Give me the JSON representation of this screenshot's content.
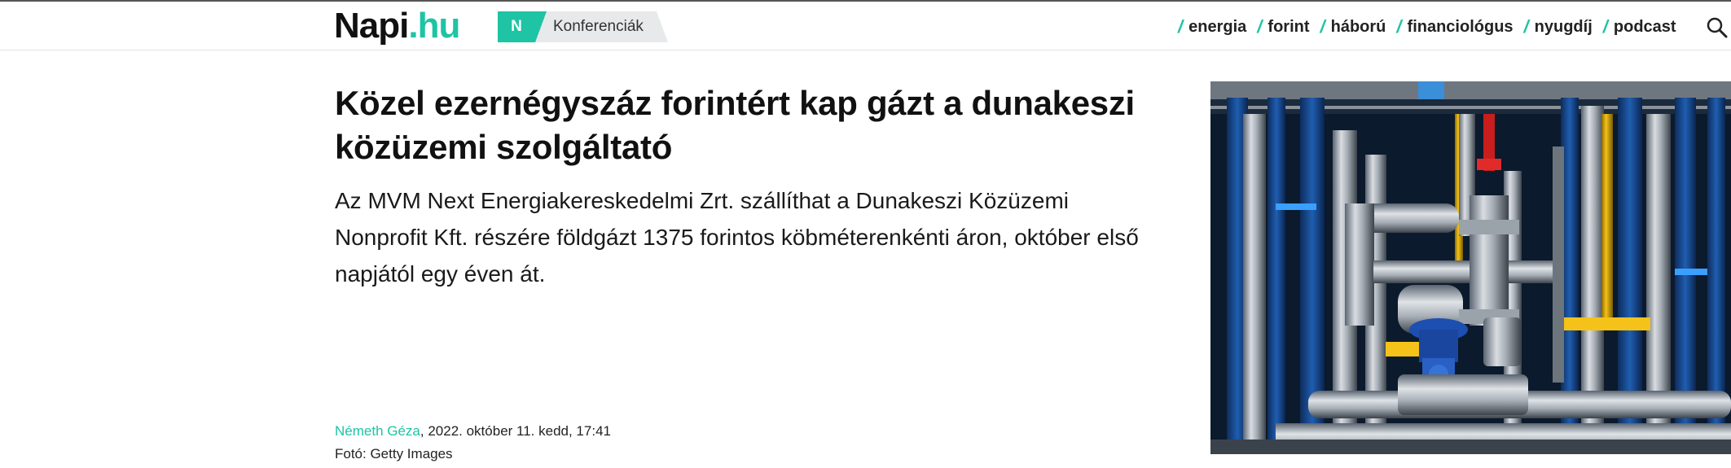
{
  "header": {
    "logo_main": "Napi",
    "logo_suffix": ".hu",
    "conference_badge": "N",
    "conference_label": "Konferenciák",
    "nav": [
      "energia",
      "forint",
      "háború",
      "financiológus",
      "nyugdíj",
      "podcast"
    ],
    "search_icon": "search-icon",
    "accent_color": "#1ec4a4"
  },
  "article": {
    "title": "Közel ezernégyszáz forintért kap gázt a dunakeszi közüzemi szolgáltató",
    "lead": "Az MVM Next Energiakereskedelmi Zrt. szállíthat a Dunakeszi Közüzemi Nonprofit Kft. részére földgázt 1375 forintos köbméterenkénti áron, október első napjától egy éven át.",
    "author": "Németh Géza",
    "date": ", 2022. október 11. kedd, 17:41",
    "photo_credit": "Fotó: Getty Images"
  }
}
